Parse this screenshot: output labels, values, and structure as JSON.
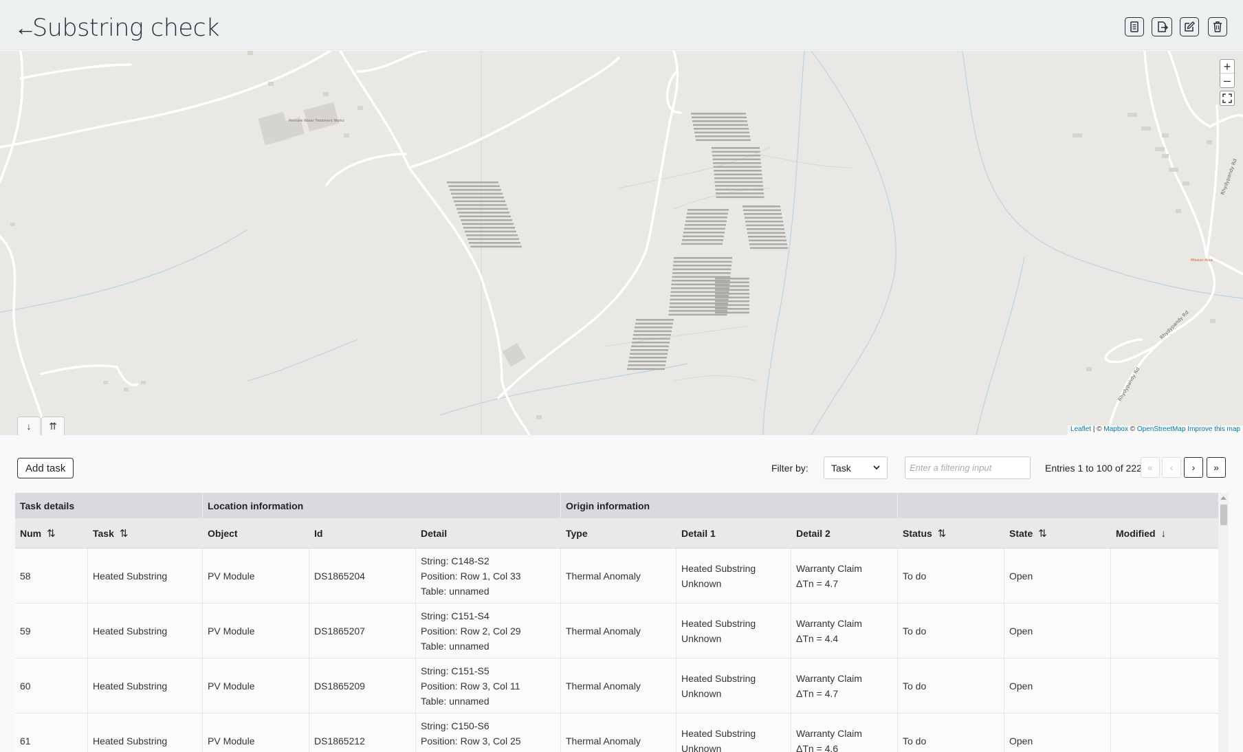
{
  "header": {
    "back_arrow": "←",
    "title": "Substring check",
    "buttons": [
      "report-icon",
      "export-icon",
      "edit-icon",
      "delete-icon"
    ]
  },
  "map": {
    "zoom_in": "+",
    "zoom_out": "–",
    "tab_down": "↓",
    "tab_up": "⇈",
    "poi_left": "Pennare Water Treatment Works",
    "poi_right": "Mission Area",
    "road_label_1": "Rhydypandy Rd",
    "road_label_2": "Rhydypandy Rd",
    "road_label_3": "Rhydypandy Rd",
    "attribution_leaflet": "Leaflet",
    "attribution_sep": " | © ",
    "attribution_mapbox": "Mapbox",
    "attribution_copy": " © ",
    "attribution_osm": "OpenStreetMap",
    "attribution_improve": " Improve this map"
  },
  "toolbar": {
    "add_task": "Add task",
    "filter_label": "Filter by:",
    "filter_value": "Task",
    "filter_placeholder": "Enter a filtering input",
    "entries": "Entries 1 to 100 of 222",
    "pg_first": "«",
    "pg_prev": "‹",
    "pg_next": "›",
    "pg_last": "»"
  },
  "table": {
    "groups": [
      "Task details",
      "Location information",
      "Origin information",
      ""
    ],
    "columns": [
      "Num",
      "Task",
      "Object",
      "Id",
      "Detail",
      "Type",
      "Detail 1",
      "Detail 2",
      "Status",
      "State",
      "Modified"
    ],
    "rows": [
      {
        "num": "58",
        "task": "Heated Substring",
        "object": "PV Module",
        "id": "DS1865204",
        "detail": [
          "String: C148-S2",
          "Position: Row 1, Col 33",
          "Table: unnamed"
        ],
        "type": "Thermal Anomaly",
        "detail1": [
          "Heated Substring",
          "Unknown"
        ],
        "detail2": [
          "Warranty Claim",
          "ΔTn = 4.7"
        ],
        "status": "To do",
        "state": "Open",
        "modified": ""
      },
      {
        "num": "59",
        "task": "Heated Substring",
        "object": "PV Module",
        "id": "DS1865207",
        "detail": [
          "String: C151-S4",
          "Position: Row 2, Col 29",
          "Table: unnamed"
        ],
        "type": "Thermal Anomaly",
        "detail1": [
          "Heated Substring",
          "Unknown"
        ],
        "detail2": [
          "Warranty Claim",
          "ΔTn = 4.4"
        ],
        "status": "To do",
        "state": "Open",
        "modified": ""
      },
      {
        "num": "60",
        "task": "Heated Substring",
        "object": "PV Module",
        "id": "DS1865209",
        "detail": [
          "String: C151-S5",
          "Position: Row 3, Col 11",
          "Table: unnamed"
        ],
        "type": "Thermal Anomaly",
        "detail1": [
          "Heated Substring",
          "Unknown"
        ],
        "detail2": [
          "Warranty Claim",
          "ΔTn = 4.7"
        ],
        "status": "To do",
        "state": "Open",
        "modified": ""
      },
      {
        "num": "61",
        "task": "Heated Substring",
        "object": "PV Module",
        "id": "DS1865212",
        "detail": [
          "String: C150-S6",
          "Position: Row 3, Col 25",
          "Table: unnamed"
        ],
        "type": "Thermal Anomaly",
        "detail1": [
          "Heated Substring",
          "Unknown"
        ],
        "detail2": [
          "Warranty Claim",
          "ΔTn = 4.6"
        ],
        "status": "To do",
        "state": "Open",
        "modified": ""
      }
    ]
  }
}
